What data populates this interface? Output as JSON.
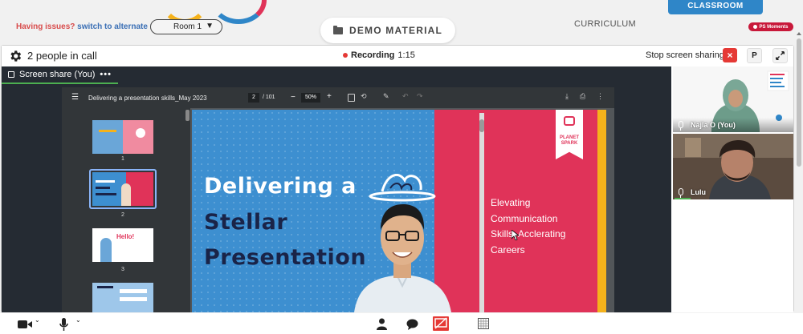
{
  "header": {
    "issues_question": "Having issues?",
    "issues_link": "switch to alternate room",
    "room_selected": "Room 1",
    "demo_material_label": "DEMO MATERIAL",
    "curriculum_label": "CURRICULUM",
    "classroom_label": "CLASSROOM",
    "ps_moments_label": "PS Moments"
  },
  "callbar": {
    "people_count_label": "2 people in call",
    "recording_label": "Recording",
    "recording_time": "1:15",
    "stop_screen_sharing_label": "Stop screen sharing",
    "close_label": "×",
    "p_label": "P"
  },
  "screen_share": {
    "tab_label": "Screen share (You)",
    "more_label": "•••"
  },
  "pdf_viewer": {
    "document_title": "Delivering a presentation skills_May 2023",
    "current_page": "2",
    "total_pages": "/ 101",
    "zoom_level": "50%",
    "thumbnails": [
      {
        "number": "1"
      },
      {
        "number": "2",
        "selected": true
      },
      {
        "number": "3"
      }
    ],
    "thumb3_text": "Hello!"
  },
  "slide": {
    "heading_line1": "Delivering a",
    "heading_line2": "Stellar",
    "heading_line3": "Presentation",
    "subtitle_line1": "Elevating",
    "subtitle_line2": "Communication",
    "subtitle_line3": "Skills, Acclerating",
    "subtitle_line4": "Careers",
    "logo_line1": "PLANET",
    "logo_line2": "SPARK",
    "colors": {
      "blue": "#3d8fd0",
      "red": "#e03359",
      "navy": "#1a2448",
      "yellow": "#f5b21b"
    }
  },
  "participants": [
    {
      "name": "Najla O (You)"
    },
    {
      "name": "Lulu"
    }
  ],
  "bottom_controls": {
    "camera_icon": "video-camera-icon",
    "mic_icon": "microphone-icon",
    "participants_icon": "person-icon",
    "chat_icon": "chat-bubble-icon",
    "screen_share_icon": "screen-share-icon",
    "whiteboard_icon": "whiteboard-icon"
  },
  "accent_colors": {
    "recording": "#e53935",
    "classroom": "#2f86c8",
    "share_active": "#4caf50"
  }
}
